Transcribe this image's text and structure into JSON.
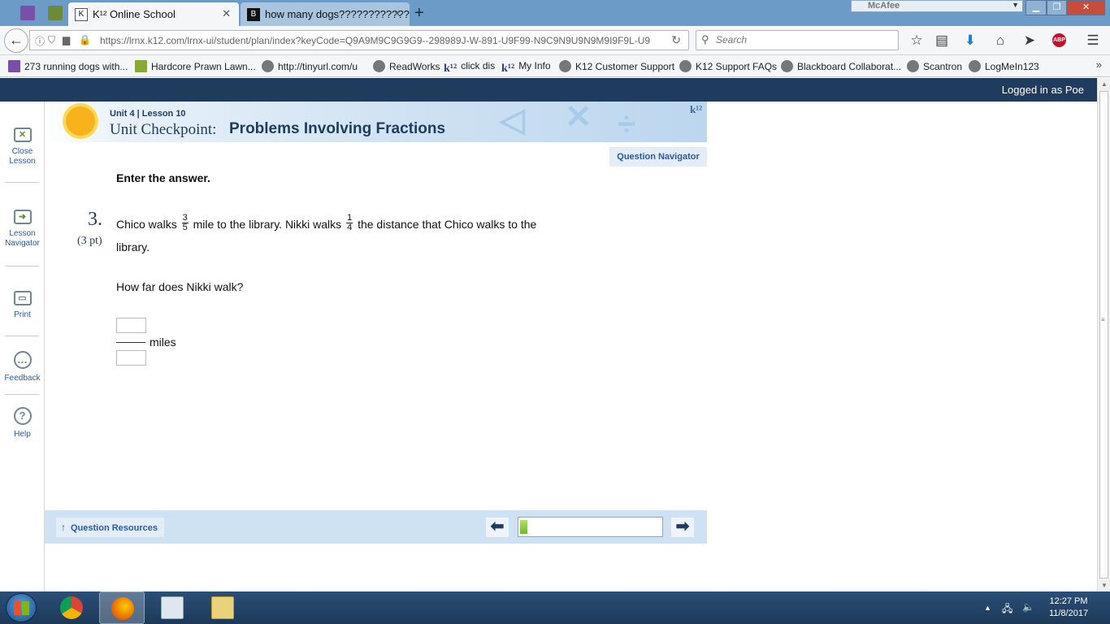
{
  "browser": {
    "tabs": [
      {
        "title": "K¹² Online School",
        "active": true
      },
      {
        "title": "how many dogs????????????",
        "active": false
      }
    ],
    "new_tab_label": "+",
    "mcafee_label": "McAfee",
    "url": "https://lrnx.k12.com/lrnx-ui/student/plan/index?keyCode=Q9A9M9C9G9G9--298989J-W-891-U9F99-N9C9N9U9N9M9I9F9L-U9",
    "search_placeholder": "Search",
    "bookmarks": [
      "273 running dogs with...",
      "Hardcore Prawn Lawn...",
      "http://tinyurl.com/u",
      "ReadWorks",
      "click dis",
      "My Info",
      "K12 Customer Support",
      "K12 Support FAQs",
      "Blackboard Collaborat...",
      "Scantron",
      "LogMeIn123"
    ],
    "more_bookmarks": "»",
    "adblock_label": "ABP"
  },
  "page": {
    "logged_in_text": "Logged in as Poe",
    "left_nav": [
      {
        "label": "Close Lesson",
        "icon": "close-lesson-icon"
      },
      {
        "label": "Lesson Navigator",
        "icon": "lesson-navigator-icon"
      },
      {
        "label": "Print",
        "icon": "print-icon"
      },
      {
        "label": "Feedback",
        "icon": "feedback-icon"
      },
      {
        "label": "Help",
        "icon": "help-icon"
      }
    ],
    "header": {
      "unit_lesson": "Unit 4 | Lesson 10",
      "title_prefix": "Unit Checkpoint:",
      "title": "Problems Involving Fractions",
      "logo": "k¹²"
    },
    "question_navigator_label": "Question Navigator",
    "instruction": "Enter the answer.",
    "question": {
      "number": "3.",
      "points": "(3 pt)",
      "text_part1": "Chico walks",
      "frac1_num": "3",
      "frac1_den": "5",
      "text_part2": "mile to the library. Nikki walks",
      "frac2_num": "1",
      "frac2_den": "4",
      "text_part3": "the distance that Chico walks to the library.",
      "ask": "How far does Nikki walk?",
      "answer_numerator": "",
      "answer_denominator": "",
      "answer_unit": "miles"
    },
    "bottom": {
      "resources_label": "Question Resources",
      "progress_fraction": 0.05
    }
  },
  "taskbar": {
    "time": "12:27 PM",
    "date": "11/8/2017"
  },
  "colors": {
    "page_header_bg": "#1f3c5e",
    "link_blue": "#2a5aa0",
    "browser_tabbar": "#6d9bc7"
  }
}
